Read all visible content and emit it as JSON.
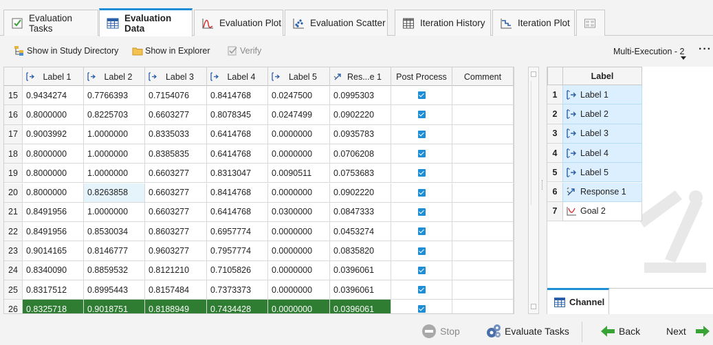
{
  "tabs": [
    {
      "label": "Evaluation Tasks",
      "icon": "checklist-icon",
      "active": false
    },
    {
      "label": "Evaluation Data",
      "icon": "table-icon",
      "active": true
    },
    {
      "label": "Evaluation Plot",
      "icon": "line-plot-icon",
      "active": false
    },
    {
      "label": "Evaluation Scatter",
      "icon": "scatter-icon",
      "active": false
    },
    {
      "label": "Iteration History",
      "icon": "grid-icon",
      "active": false
    },
    {
      "label": "Iteration Plot",
      "icon": "step-plot-icon",
      "active": false
    },
    {
      "label": "",
      "icon": "extra-view-icon",
      "active": false
    }
  ],
  "toolbar": {
    "show_in_study_directory": "Show in Study Directory",
    "show_in_explorer": "Show in Explorer",
    "verify": "Verify",
    "multi_execution": "Multi-Execution - 2",
    "more": "···"
  },
  "grid": {
    "columns": [
      "",
      "Label 1",
      "Label 2",
      "Label 3",
      "Label 4",
      "Label 5",
      "Res...e 1",
      "Post Process",
      "Comment"
    ],
    "rows": [
      [
        "15",
        "0.9434274",
        "0.7766393",
        "0.7154076",
        "0.8414768",
        "0.0247500",
        "0.0995303"
      ],
      [
        "16",
        "0.8000000",
        "0.8225703",
        "0.6603277",
        "0.8078345",
        "0.0247499",
        "0.0902220"
      ],
      [
        "17",
        "0.9003992",
        "1.0000000",
        "0.8335033",
        "0.6414768",
        "0.0000000",
        "0.0935783"
      ],
      [
        "18",
        "0.8000000",
        "1.0000000",
        "0.8385835",
        "0.6414768",
        "0.0000000",
        "0.0706208"
      ],
      [
        "19",
        "0.8000000",
        "1.0000000",
        "0.6603277",
        "0.8313047",
        "0.0090511",
        "0.0753683"
      ],
      [
        "20",
        "0.8000000",
        "0.8263858",
        "0.6603277",
        "0.8414768",
        "0.0000000",
        "0.0902220"
      ],
      [
        "21",
        "0.8491956",
        "1.0000000",
        "0.6603277",
        "0.6414768",
        "0.0300000",
        "0.0847333"
      ],
      [
        "22",
        "0.8491956",
        "0.8530034",
        "0.8603277",
        "0.6957774",
        "0.0000000",
        "0.0453274"
      ],
      [
        "23",
        "0.9014165",
        "0.8146777",
        "0.9603277",
        "0.7957774",
        "0.0000000",
        "0.0835820"
      ],
      [
        "24",
        "0.8340090",
        "0.8859532",
        "0.8121210",
        "0.7105826",
        "0.0000000",
        "0.0396061"
      ],
      [
        "25",
        "0.8317512",
        "0.8995443",
        "0.8157484",
        "0.7373373",
        "0.0000000",
        "0.0396061"
      ],
      [
        "26",
        "0.8325718",
        "0.9018751",
        "0.8188949",
        "0.7434428",
        "0.0000000",
        "0.0396061"
      ]
    ],
    "selected_row": "26",
    "highlight_color": "#2f7d32"
  },
  "channel_panel": {
    "header": "Label",
    "items": [
      {
        "num": "1",
        "label": "Label 1",
        "icon": "variable-icon"
      },
      {
        "num": "2",
        "label": "Label 2",
        "icon": "variable-icon"
      },
      {
        "num": "3",
        "label": "Label 3",
        "icon": "variable-icon"
      },
      {
        "num": "4",
        "label": "Label 4",
        "icon": "variable-icon"
      },
      {
        "num": "5",
        "label": "Label 5",
        "icon": "variable-icon"
      },
      {
        "num": "6",
        "label": "Response 1",
        "icon": "response-icon"
      },
      {
        "num": "7",
        "label": "Goal 2",
        "icon": "goal-icon"
      }
    ],
    "tab_label": "Channel"
  },
  "bottom": {
    "stop": "Stop",
    "evaluate_tasks": "Evaluate Tasks",
    "back": "Back",
    "next": "Next"
  },
  "colors": {
    "accent": "#1e8fd6",
    "selection_green": "#2f7d32",
    "arrow_green": "#3aa335"
  }
}
